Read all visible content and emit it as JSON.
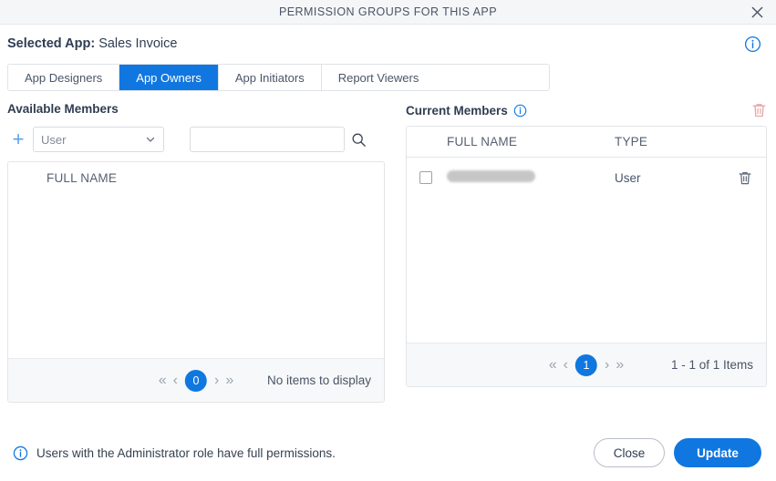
{
  "titlebar": {
    "title": "PERMISSION GROUPS FOR THIS APP",
    "close_icon": "close-icon"
  },
  "header": {
    "selected_app_label": "Selected App:",
    "selected_app_value": "Sales Invoice",
    "info_icon": "info-icon"
  },
  "tabs": [
    {
      "label": "App Designers",
      "active": false
    },
    {
      "label": "App Owners",
      "active": true
    },
    {
      "label": "App Initiators",
      "active": false
    },
    {
      "label": "Report Viewers",
      "active": false
    }
  ],
  "available_members": {
    "title": "Available Members",
    "add_icon": "plus-icon",
    "member_type": {
      "value": "User",
      "chevron_icon": "chevron-down-icon"
    },
    "search": {
      "value": "",
      "placeholder": "",
      "icon": "search-icon"
    },
    "columns": [
      "FULL NAME"
    ],
    "rows": [],
    "pager": {
      "first_icon": "«",
      "prev_icon": "‹",
      "page": "0",
      "next_icon": "›",
      "last_icon": "»"
    },
    "status": "No items to display"
  },
  "current_members": {
    "title": "Current Members",
    "info_icon": "info-icon",
    "delete_all_icon": "trash-icon",
    "columns": [
      "FULL NAME",
      "TYPE"
    ],
    "rows": [
      {
        "checked": false,
        "full_name": "",
        "full_name_redacted": true,
        "type": "User",
        "row_delete_icon": "trash-icon"
      }
    ],
    "pager": {
      "first_icon": "«",
      "prev_icon": "‹",
      "page": "1",
      "next_icon": "›",
      "last_icon": "»"
    },
    "status": "1 - 1 of 1 Items"
  },
  "footer": {
    "note_icon": "info-icon",
    "note": "Users with the Administrator role have full permissions.",
    "close_label": "Close",
    "update_label": "Update"
  },
  "colors": {
    "accent": "#1177e0",
    "titlebar_bg": "#f5f6f7",
    "text": "#3c4858",
    "muted": "#808a96",
    "danger_muted": "#e6a6ab",
    "redaction": "#c4c4c4"
  }
}
